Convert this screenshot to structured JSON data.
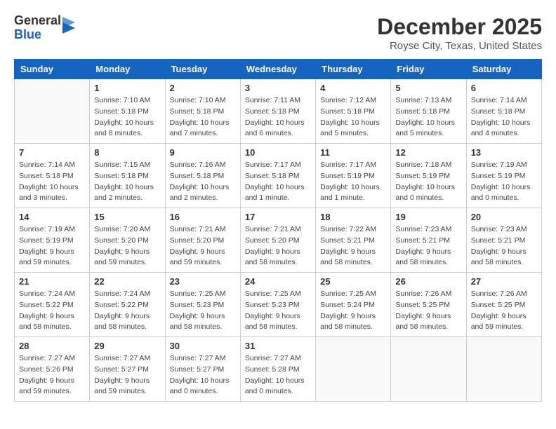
{
  "header": {
    "logo_general": "General",
    "logo_blue": "Blue",
    "month": "December 2025",
    "location": "Royse City, Texas, United States"
  },
  "days_of_week": [
    "Sunday",
    "Monday",
    "Tuesday",
    "Wednesday",
    "Thursday",
    "Friday",
    "Saturday"
  ],
  "weeks": [
    [
      {
        "day": "",
        "info": ""
      },
      {
        "day": "1",
        "info": "Sunrise: 7:10 AM\nSunset: 5:18 PM\nDaylight: 10 hours\nand 8 minutes."
      },
      {
        "day": "2",
        "info": "Sunrise: 7:10 AM\nSunset: 5:18 PM\nDaylight: 10 hours\nand 7 minutes."
      },
      {
        "day": "3",
        "info": "Sunrise: 7:11 AM\nSunset: 5:18 PM\nDaylight: 10 hours\nand 6 minutes."
      },
      {
        "day": "4",
        "info": "Sunrise: 7:12 AM\nSunset: 5:18 PM\nDaylight: 10 hours\nand 5 minutes."
      },
      {
        "day": "5",
        "info": "Sunrise: 7:13 AM\nSunset: 5:18 PM\nDaylight: 10 hours\nand 5 minutes."
      },
      {
        "day": "6",
        "info": "Sunrise: 7:14 AM\nSunset: 5:18 PM\nDaylight: 10 hours\nand 4 minutes."
      }
    ],
    [
      {
        "day": "7",
        "info": "Sunrise: 7:14 AM\nSunset: 5:18 PM\nDaylight: 10 hours\nand 3 minutes."
      },
      {
        "day": "8",
        "info": "Sunrise: 7:15 AM\nSunset: 5:18 PM\nDaylight: 10 hours\nand 2 minutes."
      },
      {
        "day": "9",
        "info": "Sunrise: 7:16 AM\nSunset: 5:18 PM\nDaylight: 10 hours\nand 2 minutes."
      },
      {
        "day": "10",
        "info": "Sunrise: 7:17 AM\nSunset: 5:18 PM\nDaylight: 10 hours\nand 1 minute."
      },
      {
        "day": "11",
        "info": "Sunrise: 7:17 AM\nSunset: 5:19 PM\nDaylight: 10 hours\nand 1 minute."
      },
      {
        "day": "12",
        "info": "Sunrise: 7:18 AM\nSunset: 5:19 PM\nDaylight: 10 hours\nand 0 minutes."
      },
      {
        "day": "13",
        "info": "Sunrise: 7:19 AM\nSunset: 5:19 PM\nDaylight: 10 hours\nand 0 minutes."
      }
    ],
    [
      {
        "day": "14",
        "info": "Sunrise: 7:19 AM\nSunset: 5:19 PM\nDaylight: 9 hours\nand 59 minutes."
      },
      {
        "day": "15",
        "info": "Sunrise: 7:20 AM\nSunset: 5:20 PM\nDaylight: 9 hours\nand 59 minutes."
      },
      {
        "day": "16",
        "info": "Sunrise: 7:21 AM\nSunset: 5:20 PM\nDaylight: 9 hours\nand 59 minutes."
      },
      {
        "day": "17",
        "info": "Sunrise: 7:21 AM\nSunset: 5:20 PM\nDaylight: 9 hours\nand 58 minutes."
      },
      {
        "day": "18",
        "info": "Sunrise: 7:22 AM\nSunset: 5:21 PM\nDaylight: 9 hours\nand 58 minutes."
      },
      {
        "day": "19",
        "info": "Sunrise: 7:23 AM\nSunset: 5:21 PM\nDaylight: 9 hours\nand 58 minutes."
      },
      {
        "day": "20",
        "info": "Sunrise: 7:23 AM\nSunset: 5:21 PM\nDaylight: 9 hours\nand 58 minutes."
      }
    ],
    [
      {
        "day": "21",
        "info": "Sunrise: 7:24 AM\nSunset: 5:22 PM\nDaylight: 9 hours\nand 58 minutes."
      },
      {
        "day": "22",
        "info": "Sunrise: 7:24 AM\nSunset: 5:22 PM\nDaylight: 9 hours\nand 58 minutes."
      },
      {
        "day": "23",
        "info": "Sunrise: 7:25 AM\nSunset: 5:23 PM\nDaylight: 9 hours\nand 58 minutes."
      },
      {
        "day": "24",
        "info": "Sunrise: 7:25 AM\nSunset: 5:23 PM\nDaylight: 9 hours\nand 58 minutes."
      },
      {
        "day": "25",
        "info": "Sunrise: 7:25 AM\nSunset: 5:24 PM\nDaylight: 9 hours\nand 58 minutes."
      },
      {
        "day": "26",
        "info": "Sunrise: 7:26 AM\nSunset: 5:25 PM\nDaylight: 9 hours\nand 58 minutes."
      },
      {
        "day": "27",
        "info": "Sunrise: 7:26 AM\nSunset: 5:25 PM\nDaylight: 9 hours\nand 59 minutes."
      }
    ],
    [
      {
        "day": "28",
        "info": "Sunrise: 7:27 AM\nSunset: 5:26 PM\nDaylight: 9 hours\nand 59 minutes."
      },
      {
        "day": "29",
        "info": "Sunrise: 7:27 AM\nSunset: 5:27 PM\nDaylight: 9 hours\nand 59 minutes."
      },
      {
        "day": "30",
        "info": "Sunrise: 7:27 AM\nSunset: 5:27 PM\nDaylight: 10 hours\nand 0 minutes."
      },
      {
        "day": "31",
        "info": "Sunrise: 7:27 AM\nSunset: 5:28 PM\nDaylight: 10 hours\nand 0 minutes."
      },
      {
        "day": "",
        "info": ""
      },
      {
        "day": "",
        "info": ""
      },
      {
        "day": "",
        "info": ""
      }
    ]
  ]
}
